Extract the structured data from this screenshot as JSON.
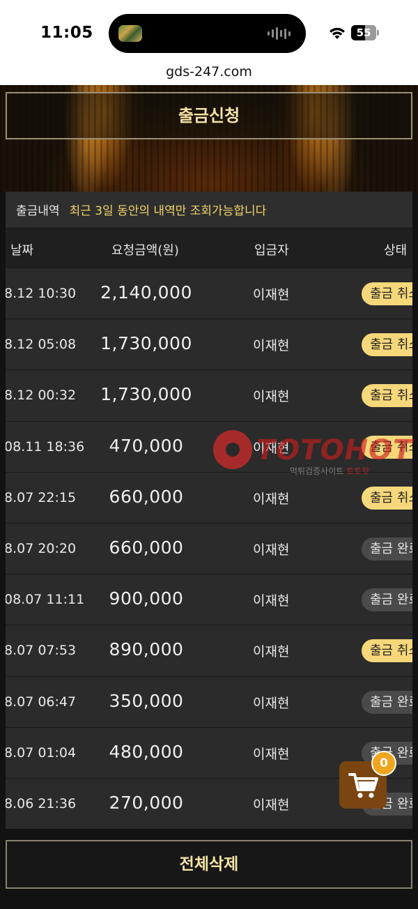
{
  "status_bar": {
    "time": "11:05",
    "battery": "55"
  },
  "browser": {
    "url": "gds-247.com"
  },
  "page": {
    "apply_button": "출금신청",
    "history_title": "출금내역",
    "history_note": "최근 3일 동안의 내역만 조회가능합니다",
    "columns": {
      "date": "날짜",
      "amount": "요청금액(원)",
      "depositor": "입금자",
      "status": "상태"
    },
    "rows": [
      {
        "date": "8.12 10:30",
        "amount": "2,140,000",
        "name": "이재현",
        "status": "출금 취소",
        "kind": "cancel"
      },
      {
        "date": "8.12 05:08",
        "amount": "1,730,000",
        "name": "이재현",
        "status": "출금 취소",
        "kind": "cancel"
      },
      {
        "date": "8.12 00:32",
        "amount": "1,730,000",
        "name": "이재현",
        "status": "출금 취소",
        "kind": "cancel"
      },
      {
        "date": "08.11 18:36",
        "amount": "470,000",
        "name": "이재현",
        "status": "출금 취소",
        "kind": "cancel"
      },
      {
        "date": "8.07 22:15",
        "amount": "660,000",
        "name": "이재현",
        "status": "출금 취소",
        "kind": "cancel"
      },
      {
        "date": "8.07 20:20",
        "amount": "660,000",
        "name": "이재현",
        "status": "출금 완료",
        "kind": "done"
      },
      {
        "date": "08.07 11:11",
        "amount": "900,000",
        "name": "이재현",
        "status": "출금 완료",
        "kind": "done"
      },
      {
        "date": "8.07 07:53",
        "amount": "890,000",
        "name": "이재현",
        "status": "출금 취소",
        "kind": "cancel"
      },
      {
        "date": "8.07 06:47",
        "amount": "350,000",
        "name": "이재현",
        "status": "출금 완료",
        "kind": "done"
      },
      {
        "date": "8.07 01:04",
        "amount": "480,000",
        "name": "이재현",
        "status": "출금 완료",
        "kind": "done"
      },
      {
        "date": "8.06 21:36",
        "amount": "270,000",
        "name": "이재현",
        "status": "출금 완료",
        "kind": "done"
      }
    ],
    "delete_all_button": "전체삭제",
    "cart_count": "0"
  },
  "watermark": {
    "brand": "TOTOHOT",
    "sub_a": "먹튀검증사이트",
    "sub_b": "토토핫"
  },
  "colors": {
    "accent": "#f6d77a",
    "cart": "#7a4510",
    "badge": "#f0a51e"
  },
  "icons": {
    "cart": "shopping-cart-icon",
    "wifi": "wifi-icon",
    "battery": "battery-icon"
  }
}
